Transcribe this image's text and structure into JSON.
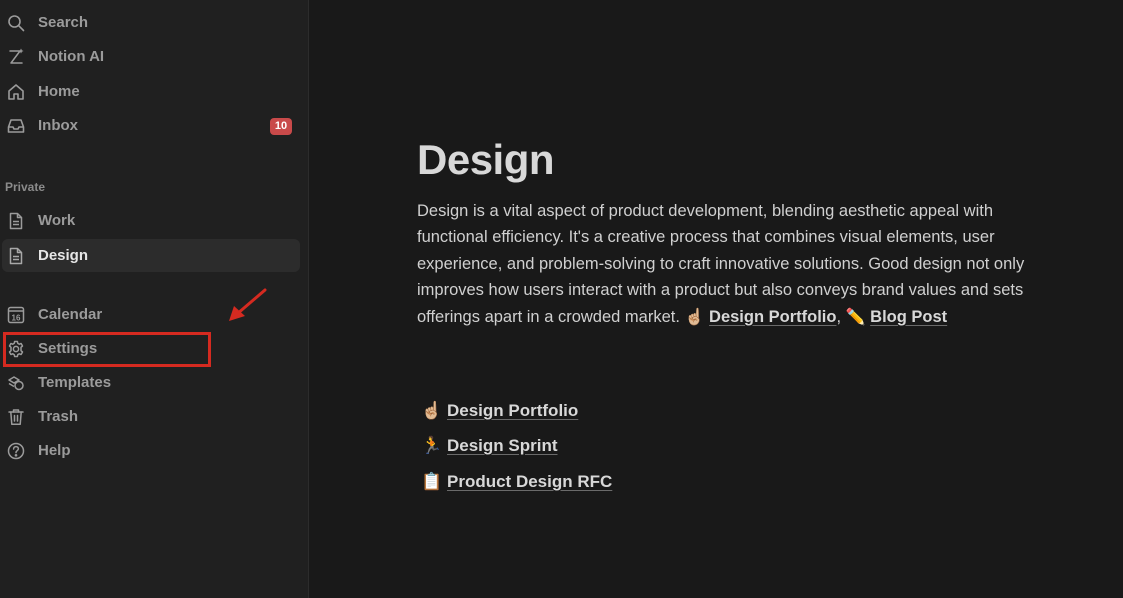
{
  "sidebar": {
    "top_items": [
      {
        "label": "Search",
        "icon": "search-icon"
      },
      {
        "label": "Notion AI",
        "icon": "notion-ai-icon"
      },
      {
        "label": "Home",
        "icon": "home-icon"
      },
      {
        "label": "Inbox",
        "icon": "inbox-icon",
        "badge": "10"
      }
    ],
    "private_section": {
      "title": "Private",
      "items": [
        {
          "label": "Work",
          "icon": "page-icon"
        },
        {
          "label": "Design",
          "icon": "page-icon",
          "active": true
        }
      ]
    },
    "bottom_items": [
      {
        "label": "Calendar",
        "icon": "calendar-icon",
        "icon_text": "16"
      },
      {
        "label": "Settings",
        "icon": "gear-icon",
        "highlighted": true
      },
      {
        "label": "Templates",
        "icon": "templates-icon"
      },
      {
        "label": "Trash",
        "icon": "trash-icon"
      },
      {
        "label": "Help",
        "icon": "help-icon"
      }
    ]
  },
  "page": {
    "title": "Design",
    "description": "Design is a vital aspect of product development, blending aesthetic appeal with functional efficiency. It's a creative process that combines visual elements, user experience, and problem-solving to craft innovative solutions. Good design not only improves how users interact with a product but also conveys brand values and sets offerings apart in a crowded market.",
    "inline_links": [
      {
        "emoji": "☝🏼",
        "label": "Design Portfolio"
      },
      {
        "emoji": "✏️",
        "label": "Blog Post"
      }
    ],
    "link_separator": ",",
    "subpages": [
      {
        "emoji": "☝🏼",
        "label": "Design Portfolio"
      },
      {
        "emoji": "🏃",
        "label": "Design Sprint"
      },
      {
        "emoji": "📋",
        "label": "Product Design RFC"
      }
    ]
  },
  "colors": {
    "background": "#191919",
    "sidebar": "#202020",
    "badge": "#c94a4a",
    "annotation": "#d52a20"
  }
}
